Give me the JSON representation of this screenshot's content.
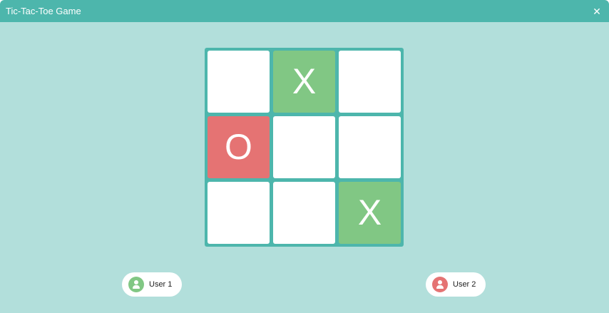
{
  "window": {
    "title": "Tic-Tac-Toe Game",
    "close_glyph": "✕"
  },
  "board": {
    "cells": [
      [
        "",
        "X",
        ""
      ],
      [
        "O",
        "",
        ""
      ],
      [
        "",
        "",
        "X"
      ]
    ]
  },
  "players": [
    {
      "name": "User 1",
      "mark": "X",
      "color": "#81c784",
      "icon": "user-icon"
    },
    {
      "name": "User 2",
      "mark": "O",
      "color": "#e57373",
      "icon": "user-icon"
    }
  ],
  "colors": {
    "background": "#b2dfdb",
    "accent": "#4db6ac",
    "x_cell": "#81c784",
    "o_cell": "#e57373"
  }
}
